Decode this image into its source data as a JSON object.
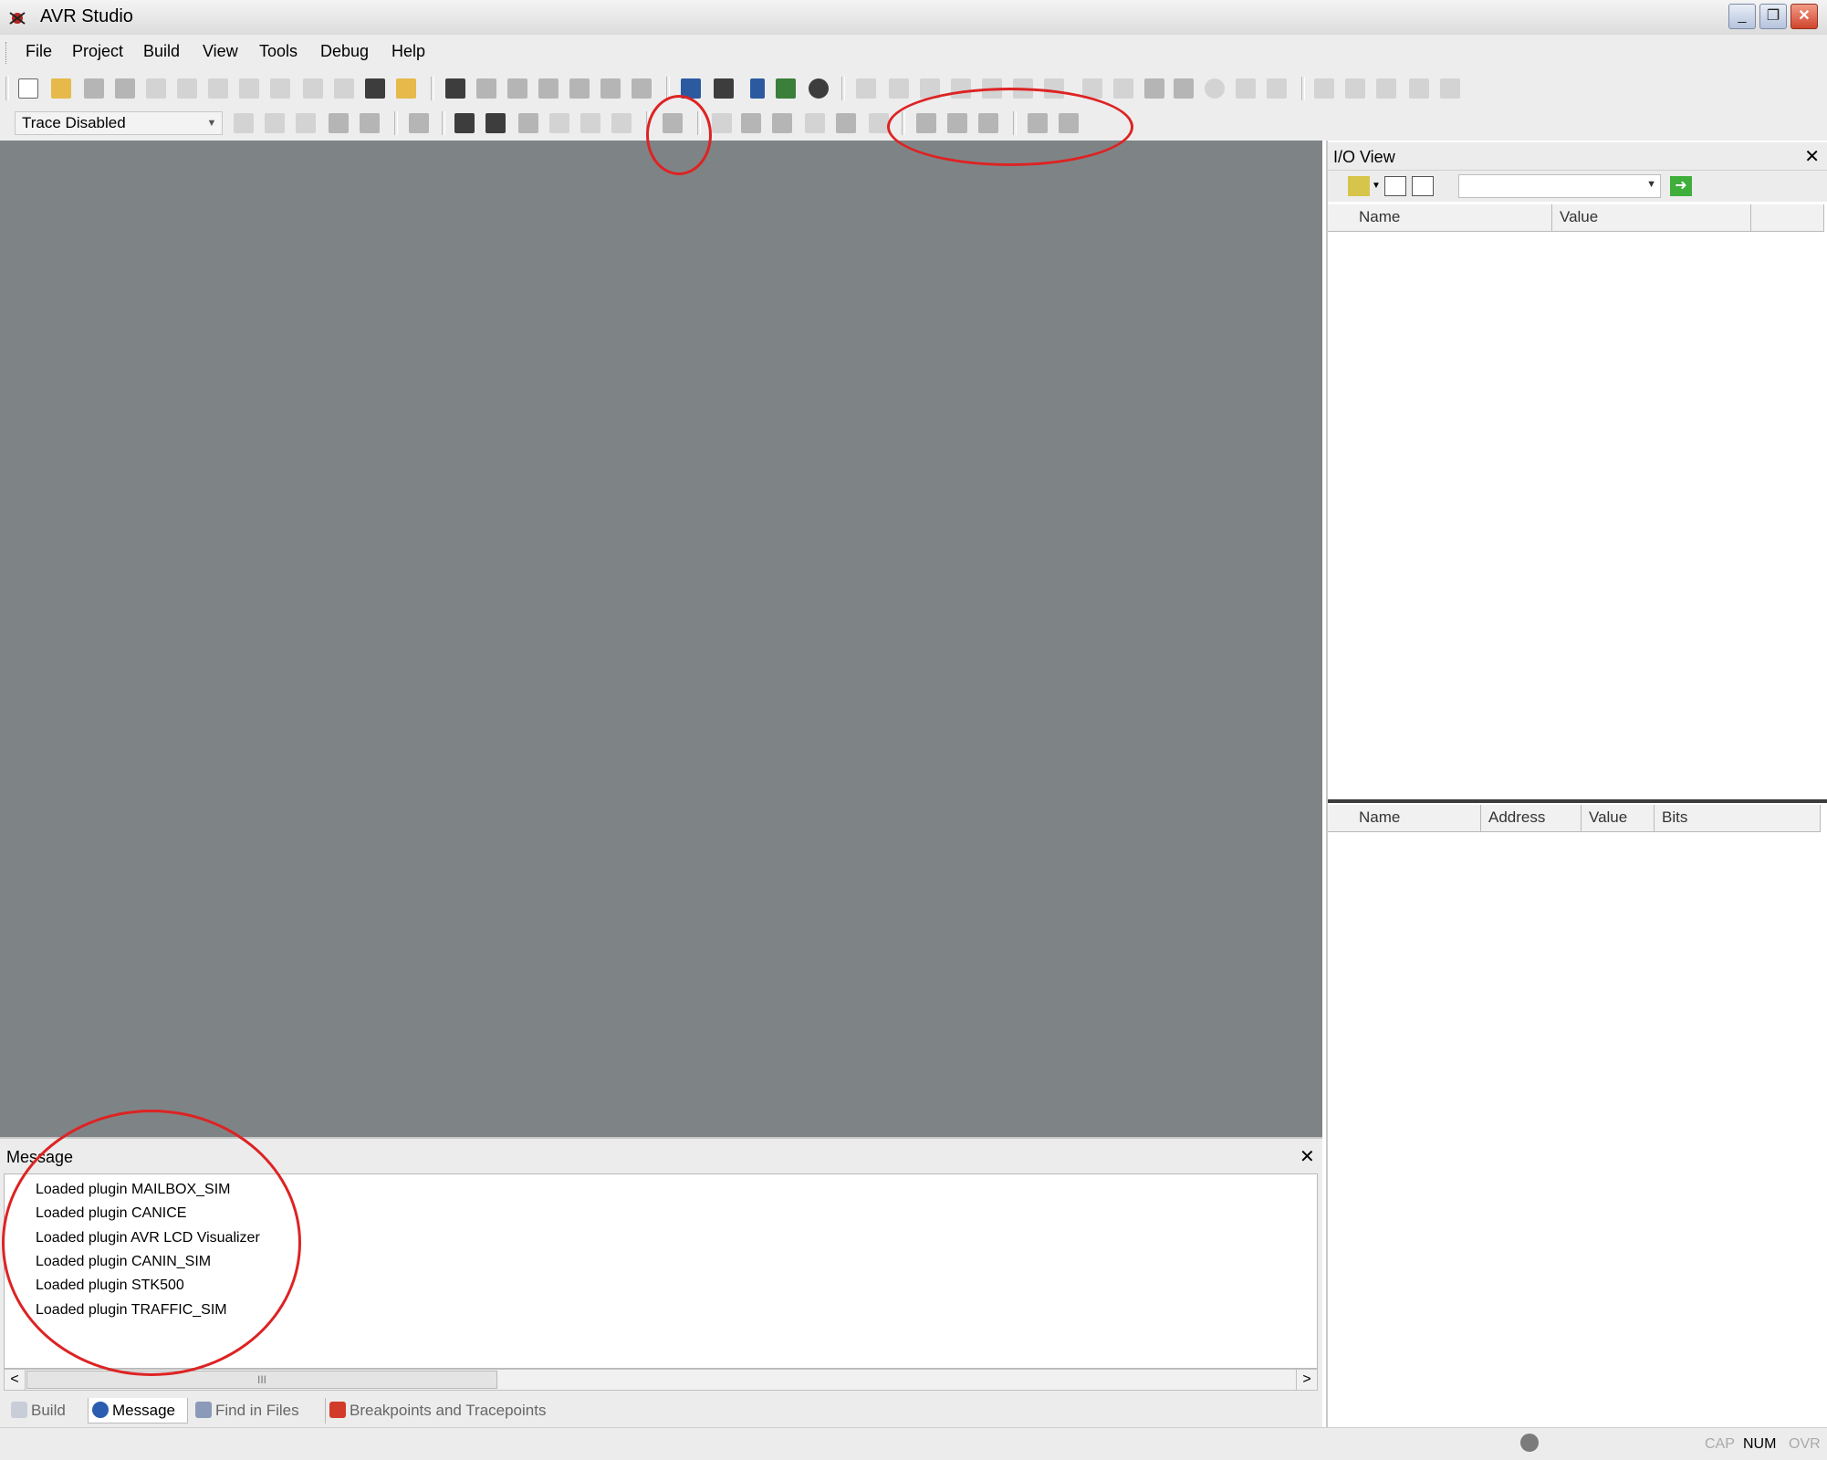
{
  "window": {
    "title": "AVR Studio"
  },
  "menu": {
    "items": [
      "File",
      "Project",
      "Build",
      "View",
      "Tools",
      "Debug",
      "Help"
    ]
  },
  "toolbar2": {
    "trace_mode": "Trace Disabled"
  },
  "io_view": {
    "title": "I/O View",
    "filter_value": "",
    "upper_columns": [
      "Name",
      "Value"
    ],
    "lower_columns": [
      "Name",
      "Address",
      "Value",
      "Bits"
    ]
  },
  "message_panel": {
    "title": "Message",
    "lines": [
      "Loaded plugin MAILBOX_SIM",
      "Loaded plugin CANICE",
      "Loaded plugin AVR LCD Visualizer",
      "Loaded plugin CANIN_SIM",
      "Loaded plugin STK500",
      "Loaded plugin TRAFFIC_SIM"
    ],
    "scroll_thumb_glyph": "III"
  },
  "tabs": [
    "Build",
    "Message",
    "Find in Files",
    "Breakpoints and Tracepoints"
  ],
  "active_tab": "Message",
  "status": {
    "cap": "CAP",
    "num": "NUM",
    "ovr": "OVR"
  },
  "colors": {
    "workspace": "#7e8486",
    "annotation": "#dd2323"
  }
}
